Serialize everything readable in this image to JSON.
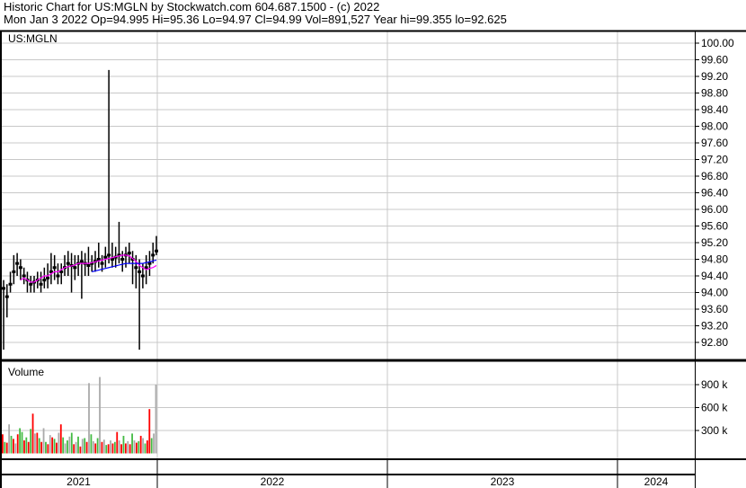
{
  "header": {
    "title": "Historic Chart for US:MGLN by Stockwatch.com 604.687.1500 - (c) 2022",
    "quote": "Mon Jan  3 2022  Op=94.995  Hi=95.36  Lo=94.97  Cl=94.99  Vol=891,527  Year hi=99.355  lo=92.625"
  },
  "chart_data": [
    {
      "type": "line",
      "title": "US:MGLN",
      "ylim": [
        92.6,
        100.2
      ],
      "yticks": [
        "100.00",
        "99.60",
        "99.20",
        "98.80",
        "98.40",
        "98.00",
        "97.60",
        "97.20",
        "96.80",
        "96.40",
        "96.00",
        "95.60",
        "95.20",
        "94.80",
        "94.40",
        "94.00",
        "93.60",
        "93.20",
        "92.80"
      ],
      "ytick_values": [
        100,
        99.6,
        99.2,
        98.8,
        98.4,
        98,
        97.6,
        97.2,
        96.8,
        96.4,
        96,
        95.6,
        95.2,
        94.8,
        94.4,
        94,
        93.6,
        93.2,
        92.8
      ],
      "x_years": [
        "2021",
        "2022",
        "2023",
        "2024"
      ],
      "close": [
        94.1,
        93.9,
        94.2,
        94.5,
        94.7,
        94.6,
        94.4,
        94.3,
        94.2,
        94.25,
        94.3,
        94.2,
        94.3,
        94.35,
        94.5,
        94.6,
        94.4,
        94.5,
        94.6,
        94.7,
        94.65,
        94.6,
        94.7,
        94.75,
        94.7,
        94.65,
        94.7,
        94.75,
        94.8,
        94.7,
        94.85,
        94.9,
        94.8,
        94.85,
        94.9,
        94.8,
        94.9,
        94.95,
        94.8,
        94.6,
        94.5,
        94.4,
        94.6,
        94.7,
        94.9,
        95.0
      ],
      "high": [
        94.3,
        94.2,
        94.5,
        94.9,
        94.95,
        94.8,
        94.6,
        94.5,
        94.4,
        94.4,
        94.5,
        94.5,
        94.6,
        94.7,
        94.95,
        94.9,
        94.7,
        94.7,
        94.9,
        95.0,
        94.95,
        94.9,
        94.9,
        95.0,
        94.95,
        95.1,
        94.9,
        95.0,
        95.2,
        94.9,
        95.1,
        99.355,
        95.2,
        95.1,
        95.7,
        95.0,
        95.1,
        95.2,
        95.0,
        94.9,
        94.8,
        94.7,
        94.9,
        95.0,
        95.2,
        95.36
      ],
      "low": [
        92.625,
        93.4,
        94.0,
        94.2,
        94.4,
        94.3,
        94.2,
        94.0,
        94.0,
        94.0,
        94.1,
        94.0,
        94.1,
        94.1,
        94.2,
        94.3,
        94.2,
        94.2,
        94.4,
        94.4,
        94.0,
        94.3,
        94.4,
        93.85,
        94.4,
        94.4,
        94.5,
        94.5,
        94.6,
        94.5,
        94.6,
        94.7,
        94.6,
        94.6,
        94.7,
        94.5,
        94.6,
        94.7,
        94.2,
        94.1,
        92.625,
        94.1,
        94.2,
        94.4,
        94.7,
        94.9
      ],
      "ma_short": [
        null,
        null,
        null,
        null,
        null,
        94.3,
        94.35,
        94.3,
        94.25,
        94.25,
        94.3,
        94.35,
        94.4,
        94.4,
        94.45,
        94.5,
        94.5,
        94.55,
        94.6,
        94.62,
        94.64,
        94.66,
        94.7,
        94.7,
        94.7,
        94.7,
        94.72,
        94.74,
        94.76,
        94.78,
        94.8,
        94.82,
        94.84,
        94.86,
        94.88,
        94.9,
        94.9,
        94.88,
        94.82,
        94.75,
        94.65,
        94.6,
        94.55,
        94.58,
        94.6,
        94.65
      ],
      "ma_long": [
        null,
        null,
        null,
        null,
        null,
        null,
        null,
        null,
        null,
        null,
        null,
        null,
        null,
        null,
        null,
        null,
        null,
        null,
        null,
        null,
        null,
        null,
        null,
        null,
        null,
        null,
        94.5,
        94.52,
        94.54,
        94.56,
        94.58,
        94.6,
        94.62,
        94.64,
        94.66,
        94.68,
        94.7,
        94.7,
        94.7,
        94.7,
        94.7,
        94.7,
        94.72,
        94.74,
        94.76,
        94.78
      ]
    },
    {
      "type": "bar",
      "title": "Volume",
      "yticks": [
        "900 k",
        "600 k",
        "300 k"
      ],
      "ytick_values": [
        900,
        600,
        300
      ],
      "ylim": [
        0,
        1100
      ],
      "values": [
        250,
        150,
        140,
        380,
        230,
        190,
        130,
        250,
        330,
        280,
        170,
        210,
        150,
        320,
        520,
        260,
        270,
        200,
        150,
        330,
        150,
        120,
        240,
        210,
        190,
        140,
        270,
        380,
        210,
        130,
        170,
        220,
        270,
        120,
        150,
        220,
        90,
        190,
        200,
        150,
        920,
        250,
        160,
        130,
        200,
        1000,
        150,
        180,
        110,
        120,
        170,
        130,
        150,
        280,
        170,
        120,
        230,
        130,
        160,
        120,
        260,
        170,
        140,
        160,
        230,
        200,
        130,
        170,
        580,
        200,
        260,
        900
      ],
      "colors": [
        "r",
        "g",
        "r",
        "gy",
        "g",
        "r",
        "gy",
        "r",
        "g",
        "g",
        "r",
        "g",
        "r",
        "g",
        "r",
        "gy",
        "r",
        "g",
        "r",
        "gy",
        "g",
        "r",
        "gy",
        "r",
        "g",
        "r",
        "gy",
        "r",
        "g",
        "gy",
        "g",
        "gy",
        "g",
        "r",
        "gy",
        "g",
        "r",
        "gy",
        "g",
        "r",
        "gy",
        "g",
        "gy",
        "r",
        "g",
        "gy",
        "r",
        "gy",
        "g",
        "r",
        "gy",
        "r",
        "g",
        "r",
        "gy",
        "r",
        "g",
        "r",
        "gy",
        "r",
        "g",
        "gy",
        "r",
        "g",
        "r",
        "gy",
        "g",
        "r",
        "r",
        "g",
        "gy",
        "gy"
      ]
    }
  ]
}
